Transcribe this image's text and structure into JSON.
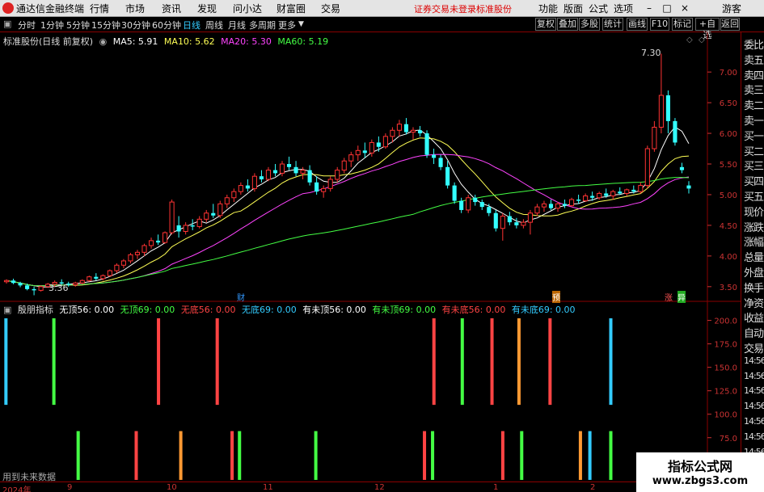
{
  "menubar": {
    "app_name": "通达信金融终端",
    "items": [
      "行情",
      "市场",
      "资讯",
      "发现",
      "问小达",
      "财富圈",
      "交易"
    ],
    "notice": "证券交易未登录",
    "notice2": "标准股份",
    "right_items": [
      "功能",
      "版面",
      "公式",
      "选项"
    ],
    "guest": "游客"
  },
  "toolbar": {
    "periods": [
      "分时",
      "1分钟",
      "5分钟",
      "15分钟",
      "30分钟",
      "60分钟",
      "日线",
      "周线",
      "月线",
      "多周期",
      "更多"
    ],
    "active_period": "日线",
    "right_buttons": [
      "复权",
      "叠加",
      "多股",
      "统计",
      "画线",
      "F10",
      "标记",
      "+自选",
      "返回"
    ]
  },
  "main_chart": {
    "stock_title": "标准股份(日线 前复权)",
    "ma": [
      {
        "label": "MA5: 5.91",
        "color": "#ffffff"
      },
      {
        "label": "MA10: 5.62",
        "color": "#ffff55"
      },
      {
        "label": "MA20: 5.30",
        "color": "#ff44ff"
      },
      {
        "label": "MA60: 5.19",
        "color": "#44ff44"
      }
    ],
    "high_label": "7.30",
    "low_label": "3.36",
    "markers": [
      "财",
      "预",
      "涨",
      "异"
    ]
  },
  "sub_chart": {
    "name": "殷朋指标",
    "legend": [
      {
        "label": "无顶56: 0.00",
        "color": "#ffffff"
      },
      {
        "label": "无顶69: 0.00",
        "color": "#44ff44"
      },
      {
        "label": "无底56: 0.00",
        "color": "#ff4444"
      },
      {
        "label": "无底69: 0.00",
        "color": "#33ccff"
      },
      {
        "label": "有未顶56: 0.00",
        "color": "#ffffff"
      },
      {
        "label": "有未顶69: 0.00",
        "color": "#44ff44"
      },
      {
        "label": "有未底56: 0.00",
        "color": "#ff4444"
      },
      {
        "label": "有未底69: 0.00",
        "color": "#33ccff"
      }
    ],
    "future_note": "用到未来数据"
  },
  "side_column": [
    "委比",
    "卖五",
    "卖四",
    "卖三",
    "卖二",
    "卖一",
    "买一",
    "买二",
    "买三",
    "买四",
    "买五",
    "现价",
    "涨跌",
    "涨幅",
    "总量",
    "外盘",
    "换手",
    "净资",
    "收益",
    "自动",
    "交易",
    "14:56",
    "14:56",
    "14:56",
    "14:56",
    "14:56",
    "14:56",
    "14:56",
    "14:56",
    "14:56"
  ],
  "date_axis": [
    "2024年",
    "9",
    "10",
    "11",
    "12",
    "1",
    "2"
  ],
  "watermark": {
    "line1": "指标公式网",
    "line2": "www.zbgs3.com"
  },
  "chart_data": [
    {
      "type": "candlestick",
      "title": "标准股份(日线 前复权)",
      "y_ticks": [
        7.0,
        6.5,
        6.0,
        5.5,
        5.0,
        4.5,
        4.0,
        3.5
      ],
      "ylim": [
        3.3,
        7.45
      ],
      "x_ticks": [
        "2024年",
        "9",
        "10",
        "11",
        "12",
        "1",
        "2"
      ],
      "ohlc": [
        [
          3.58,
          3.62,
          3.55,
          3.6
        ],
        [
          3.6,
          3.63,
          3.54,
          3.56
        ],
        [
          3.56,
          3.58,
          3.49,
          3.52
        ],
        [
          3.52,
          3.55,
          3.44,
          3.46
        ],
        [
          3.46,
          3.5,
          3.36,
          3.44
        ],
        [
          3.44,
          3.52,
          3.42,
          3.5
        ],
        [
          3.5,
          3.56,
          3.48,
          3.54
        ],
        [
          3.54,
          3.6,
          3.5,
          3.57
        ],
        [
          3.57,
          3.62,
          3.53,
          3.55
        ],
        [
          3.55,
          3.58,
          3.5,
          3.53
        ],
        [
          3.53,
          3.58,
          3.5,
          3.56
        ],
        [
          3.56,
          3.62,
          3.54,
          3.6
        ],
        [
          3.6,
          3.68,
          3.58,
          3.66
        ],
        [
          3.66,
          3.72,
          3.6,
          3.63
        ],
        [
          3.63,
          3.7,
          3.6,
          3.68
        ],
        [
          3.68,
          3.78,
          3.66,
          3.76
        ],
        [
          3.76,
          3.88,
          3.72,
          3.85
        ],
        [
          3.85,
          3.95,
          3.8,
          3.92
        ],
        [
          3.92,
          4.05,
          3.88,
          4.02
        ],
        [
          4.02,
          4.1,
          3.95,
          4.06
        ],
        [
          4.06,
          4.2,
          4.0,
          4.17
        ],
        [
          4.17,
          4.3,
          4.12,
          4.25
        ],
        [
          4.25,
          4.35,
          4.18,
          4.22
        ],
        [
          4.22,
          4.4,
          4.2,
          4.38
        ],
        [
          4.38,
          4.92,
          4.35,
          4.88
        ],
        [
          4.5,
          4.65,
          4.3,
          4.4
        ],
        [
          4.4,
          4.55,
          4.35,
          4.5
        ],
        [
          4.5,
          4.6,
          4.42,
          4.48
        ],
        [
          4.48,
          4.65,
          4.45,
          4.6
        ],
        [
          4.6,
          4.75,
          4.55,
          4.7
        ],
        [
          4.7,
          4.85,
          4.62,
          4.66
        ],
        [
          4.66,
          4.9,
          4.62,
          4.85
        ],
        [
          4.85,
          5.0,
          4.78,
          4.95
        ],
        [
          4.95,
          5.1,
          4.88,
          5.05
        ],
        [
          5.05,
          5.2,
          5.0,
          5.15
        ],
        [
          5.15,
          5.25,
          5.05,
          5.1
        ],
        [
          5.1,
          5.35,
          5.05,
          5.3
        ],
        [
          5.3,
          5.4,
          5.2,
          5.25
        ],
        [
          5.25,
          5.45,
          5.22,
          5.4
        ],
        [
          5.4,
          5.5,
          5.3,
          5.35
        ],
        [
          5.35,
          5.55,
          5.3,
          5.5
        ],
        [
          5.5,
          5.62,
          5.4,
          5.45
        ],
        [
          5.45,
          5.55,
          5.3,
          5.35
        ],
        [
          5.35,
          5.45,
          5.25,
          5.4
        ],
        [
          5.4,
          5.48,
          5.15,
          5.2
        ],
        [
          5.2,
          5.3,
          5.0,
          5.05
        ],
        [
          5.05,
          5.15,
          4.95,
          5.1
        ],
        [
          5.1,
          5.3,
          5.05,
          5.25
        ],
        [
          5.25,
          5.45,
          5.2,
          5.4
        ],
        [
          5.4,
          5.6,
          5.35,
          5.55
        ],
        [
          5.55,
          5.7,
          5.45,
          5.65
        ],
        [
          5.65,
          5.8,
          5.55,
          5.72
        ],
        [
          5.72,
          5.85,
          5.6,
          5.68
        ],
        [
          5.68,
          5.9,
          5.62,
          5.85
        ],
        [
          5.85,
          5.95,
          5.7,
          5.78
        ],
        [
          5.78,
          6.0,
          5.75,
          5.95
        ],
        [
          5.95,
          6.1,
          5.85,
          6.05
        ],
        [
          6.05,
          6.22,
          5.95,
          6.15
        ],
        [
          6.15,
          6.25,
          5.98,
          6.02
        ],
        [
          6.02,
          6.1,
          5.9,
          6.05
        ],
        [
          6.05,
          6.12,
          5.95,
          6.0
        ],
        [
          6.0,
          6.05,
          5.6,
          5.65
        ],
        [
          5.65,
          5.75,
          5.5,
          5.6
        ],
        [
          5.6,
          5.65,
          5.4,
          5.45
        ],
        [
          5.45,
          5.55,
          5.1,
          5.15
        ],
        [
          5.15,
          5.2,
          4.85,
          4.9
        ],
        [
          4.9,
          4.95,
          4.7,
          4.75
        ],
        [
          4.75,
          5.0,
          4.7,
          4.95
        ],
        [
          4.95,
          5.0,
          4.82,
          4.88
        ],
        [
          4.88,
          4.92,
          4.75,
          4.8
        ],
        [
          4.8,
          4.85,
          4.65,
          4.7
        ],
        [
          4.7,
          4.75,
          4.4,
          4.45
        ],
        [
          4.45,
          4.7,
          4.25,
          4.65
        ],
        [
          4.65,
          4.72,
          4.5,
          4.55
        ],
        [
          4.55,
          4.62,
          4.45,
          4.5
        ],
        [
          4.5,
          4.6,
          4.45,
          4.55
        ],
        [
          4.55,
          4.75,
          4.35,
          4.7
        ],
        [
          4.7,
          4.85,
          4.65,
          4.8
        ],
        [
          4.8,
          4.9,
          4.72,
          4.85
        ],
        [
          4.85,
          4.92,
          4.75,
          4.78
        ],
        [
          4.78,
          4.88,
          4.72,
          4.85
        ],
        [
          4.85,
          4.92,
          4.78,
          4.82
        ],
        [
          4.82,
          4.95,
          4.8,
          4.92
        ],
        [
          4.92,
          5.0,
          4.85,
          4.9
        ],
        [
          4.9,
          5.02,
          4.88,
          4.98
        ],
        [
          4.98,
          5.05,
          4.9,
          4.95
        ],
        [
          4.95,
          5.05,
          4.92,
          5.02
        ],
        [
          5.02,
          5.1,
          4.95,
          4.98
        ],
        [
          4.98,
          5.08,
          4.92,
          5.05
        ],
        [
          5.05,
          5.12,
          5.0,
          5.02
        ],
        [
          5.02,
          5.1,
          4.98,
          5.08
        ],
        [
          5.08,
          5.15,
          5.02,
          5.05
        ],
        [
          5.05,
          5.2,
          5.02,
          5.15
        ],
        [
          5.15,
          5.8,
          5.1,
          5.75
        ],
        [
          5.75,
          6.2,
          5.7,
          6.1
        ],
        [
          6.1,
          7.3,
          6.0,
          6.62
        ],
        [
          6.62,
          6.7,
          6.0,
          6.2
        ],
        [
          6.2,
          6.25,
          5.8,
          5.85
        ],
        [
          5.45,
          5.52,
          5.35,
          5.4
        ],
        [
          5.15,
          5.22,
          5.02,
          5.1
        ]
      ],
      "series": [
        {
          "name": "MA5",
          "last": 5.91
        },
        {
          "name": "MA10",
          "last": 5.62
        },
        {
          "name": "MA20",
          "last": 5.3
        },
        {
          "name": "MA60",
          "last": 5.19
        }
      ]
    },
    {
      "type": "bar",
      "title": "殷朋指标",
      "y_ticks": [
        200.0,
        175.0,
        150.0,
        125.0,
        100.0,
        75.0,
        50.0
      ],
      "ylim": [
        30,
        210
      ],
      "bars_top_row": [
        {
          "pos": 0.004,
          "color": "#33ccff"
        },
        {
          "pos": 0.075,
          "color": "#44ff44"
        },
        {
          "pos": 0.23,
          "color": "#ff4444"
        },
        {
          "pos": 0.317,
          "color": "#ff4444"
        },
        {
          "pos": 0.638,
          "color": "#ff4444"
        },
        {
          "pos": 0.68,
          "color": "#44ff44"
        },
        {
          "pos": 0.724,
          "color": "#ff4444"
        },
        {
          "pos": 0.764,
          "color": "#ff9933"
        },
        {
          "pos": 0.81,
          "color": "#ff4444"
        },
        {
          "pos": 0.9,
          "color": "#33ccff"
        }
      ],
      "bars_bottom_row": [
        {
          "pos": 0.111,
          "color": "#44ff44"
        },
        {
          "pos": 0.197,
          "color": "#ff4444"
        },
        {
          "pos": 0.263,
          "color": "#ff9933"
        },
        {
          "pos": 0.339,
          "color": "#ff4444"
        },
        {
          "pos": 0.35,
          "color": "#44ff44"
        },
        {
          "pos": 0.463,
          "color": "#44ff44"
        },
        {
          "pos": 0.624,
          "color": "#ff4444"
        },
        {
          "pos": 0.636,
          "color": "#44ff44"
        },
        {
          "pos": 0.74,
          "color": "#ff4444"
        },
        {
          "pos": 0.768,
          "color": "#44ff44"
        },
        {
          "pos": 0.855,
          "color": "#ff9933"
        },
        {
          "pos": 0.869,
          "color": "#33ccff"
        },
        {
          "pos": 0.9,
          "color": "#44ff44"
        }
      ]
    }
  ]
}
